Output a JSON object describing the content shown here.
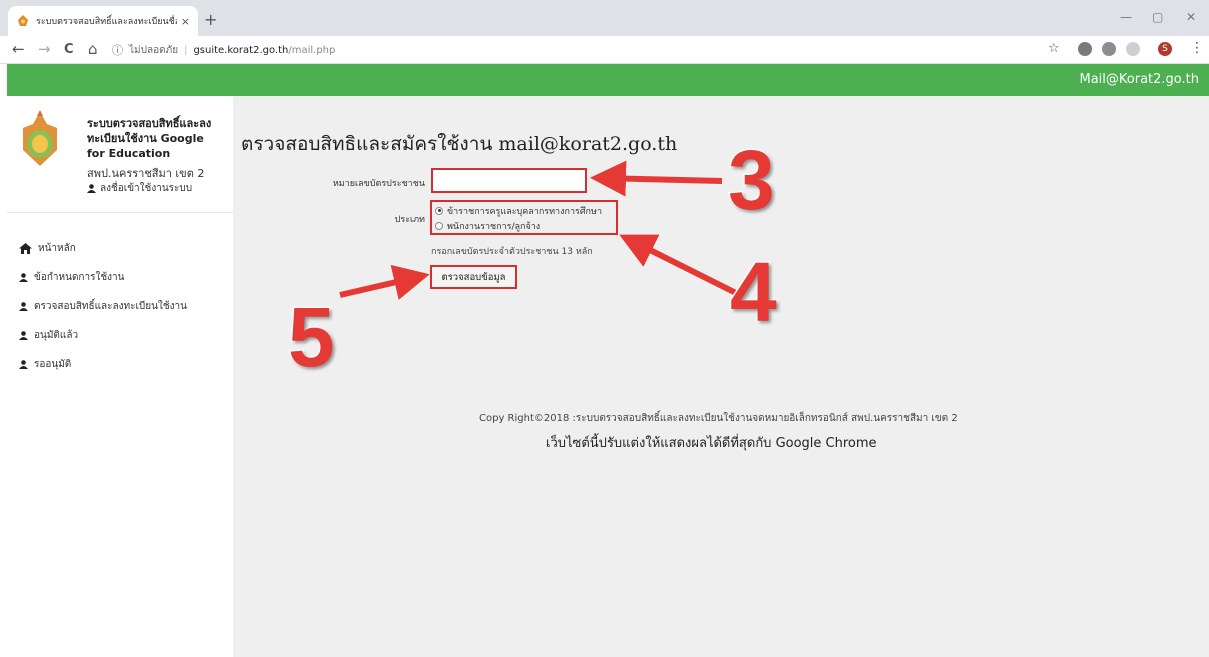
{
  "browser": {
    "tab_title": "ระบบตรวจสอบสิทธิ์และลงทะเบียนชื่อใช้",
    "tab_close": "×",
    "new_tab": "+",
    "back": "←",
    "forward": "→",
    "reload": "C",
    "home": "⌂",
    "info_icon": "ⓘ",
    "insecure_label": "ไม่ปลอดภัย",
    "separator": "|",
    "url_host": "gsuite.korat2.go.th",
    "url_path": "/mail.php",
    "star": "☆",
    "menu": "⋮",
    "minimize": "—",
    "maximize": "▢",
    "close": "✕",
    "profile_initial": "S"
  },
  "header": {
    "brand": "Mail@Korat2.go.th",
    "color": "#4caf50"
  },
  "sidebar": {
    "system_title": "ระบบตรวจสอบสิทธิ์และลงทะเบียนใช้งาน Google for Education",
    "subtitle": "สพป.นครราชสีมา เขต 2",
    "login": "ลงชื่อเข้าใช้งานระบบ",
    "items": [
      {
        "label": "หน้าหลัก",
        "icon": "home-icon"
      },
      {
        "label": "ข้อกำหนดการใช้งาน",
        "icon": "user-icon"
      },
      {
        "label": "ตรวจสอบสิทธิ์และลงทะเบียนใช้งาน",
        "icon": "user-icon"
      },
      {
        "label": "อนุมัติแล้ว",
        "icon": "user-icon"
      },
      {
        "label": "รออนุมัติ",
        "icon": "user-icon"
      }
    ]
  },
  "main": {
    "title": "ตรวจสอบสิทธิและสมัครใช้งาน mail@korat2.go.th",
    "id_label": "หมายเลขบัตรประชาชน",
    "id_value": "",
    "type_label": "ประเภท",
    "type_options": [
      {
        "label": "ข้าราชการครูและบุคลากรทางการศึกษา",
        "selected": true
      },
      {
        "label": "พนักงานราชการ/ลูกจ้าง",
        "selected": false
      }
    ],
    "hint": "กรอกเลขบัตรประจำตัวประชาชน 13 หลัก",
    "check_button": "ตรวจสอบข้อมูล",
    "footer_copyright": "Copy Right©2018 :ระบบตรวจสอบสิทธิ์และลงทะเบียนใช้งานจดหมายอิเล็กทรอนิกส์ สพป.นครราชสีมา เขต 2",
    "footer_browser": "เว็บไซต์นี้ปรับแต่งให้แสดงผลได้ดีที่สุดกับ Google Chrome"
  },
  "annotations": {
    "step3": "3",
    "step4": "4",
    "step5": "5",
    "color": "#e53935"
  }
}
